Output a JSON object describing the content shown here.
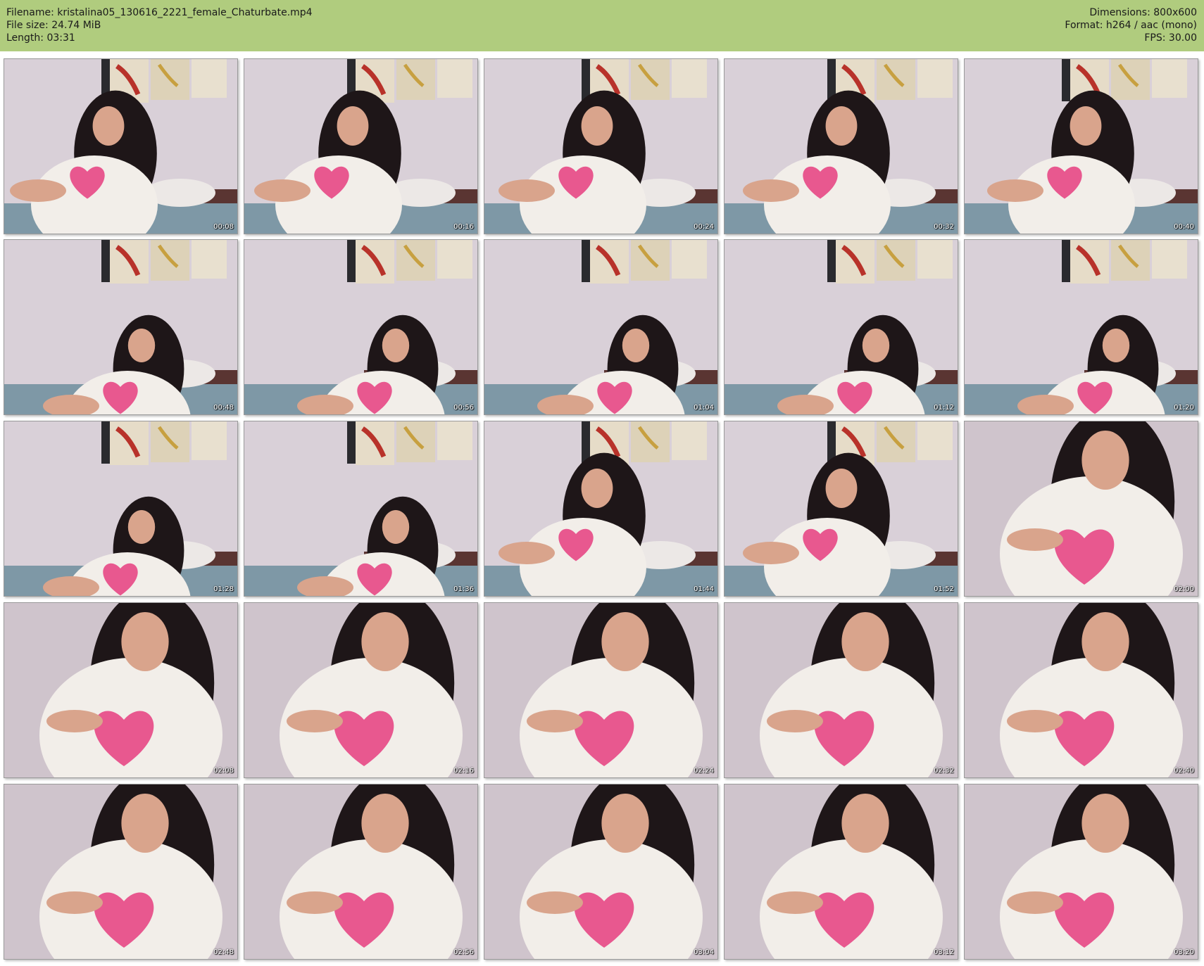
{
  "header": {
    "filename_label": "Filename: kristalina05_130616_2221_female_Chaturbate.mp4",
    "filesize_label": "File size: 24.74 MiB",
    "length_label": "Length: 03:31",
    "dimensions_label": "Dimensions: 800x600",
    "format_label": "Format: h264 / aac (mono)",
    "fps_label": "FPS: 30.00"
  },
  "colors": {
    "header_bg": "#b0cc7e",
    "wall": "#d9d0d8",
    "hair": "#1e1618",
    "skin": "#d9a48c",
    "shirt_white": "#f2eee9",
    "heart_pink": "#e8588f",
    "bed_brown": "#5a3532",
    "sheet_blue": "#7e98a6",
    "art_red": "#b8322a"
  },
  "thumbnails": [
    {
      "timestamp": "00:08"
    },
    {
      "timestamp": "00:16"
    },
    {
      "timestamp": "00:24"
    },
    {
      "timestamp": "00:32"
    },
    {
      "timestamp": "00:40"
    },
    {
      "timestamp": "00:48"
    },
    {
      "timestamp": "00:56"
    },
    {
      "timestamp": "01:04"
    },
    {
      "timestamp": "01:12"
    },
    {
      "timestamp": "01:20"
    },
    {
      "timestamp": "01:28"
    },
    {
      "timestamp": "01:36"
    },
    {
      "timestamp": "01:44"
    },
    {
      "timestamp": "01:52"
    },
    {
      "timestamp": "02:00"
    },
    {
      "timestamp": "02:08"
    },
    {
      "timestamp": "02:16"
    },
    {
      "timestamp": "02:24"
    },
    {
      "timestamp": "02:32"
    },
    {
      "timestamp": "02:40"
    },
    {
      "timestamp": "02:48"
    },
    {
      "timestamp": "02:56"
    },
    {
      "timestamp": "03:04"
    },
    {
      "timestamp": "03:12"
    },
    {
      "timestamp": "03:20"
    }
  ]
}
